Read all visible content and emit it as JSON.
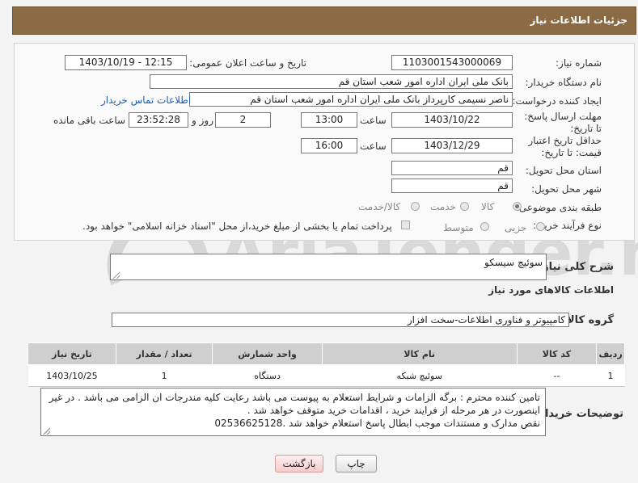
{
  "header": {
    "title": "جزئیات اطلاعات نیاز"
  },
  "form": {
    "need_number_label": "شماره نیاز:",
    "need_number": "1103001543000069",
    "announce_label": "تاریخ و ساعت اعلان عمومی:",
    "announce_value": "1403/10/19 - 12:15",
    "buyer_label": "نام دستگاه خریدار:",
    "buyer_value": "بانک ملی ایران اداره امور شعب استان قم",
    "creator_label": "ایجاد کننده درخواست:",
    "creator_value": "ناصر  نسیمی  کارپرداز  بانک ملی ایران اداره امور شعب استان قم",
    "contact_link": "اطلاعات تماس خریدار",
    "reply_deadline_label": "مهلت ارسال پاسخ: تا تاریخ:",
    "reply_date": "1403/10/22",
    "time_label": "ساعت",
    "reply_time": "13:00",
    "days_value": "2",
    "days_label": "روز و",
    "remaining_time": "23:52:28",
    "remaining_label": "ساعت باقی مانده",
    "price_deadline_label": "حداقل تاریخ اعتبار قیمت: تا تاریخ:",
    "price_date": "1403/12/29",
    "price_time": "16:00",
    "province_label": "استان محل تحویل:",
    "province_value": "قم",
    "city_label": "شهر محل تحویل:",
    "city_value": "قم",
    "category_label": "طبقه بندی موضوعی:",
    "category_options": [
      "کالا",
      "خدمت",
      "کالا/خدمت"
    ],
    "category_selected": "کالا",
    "process_label": "نوع فرآیند خرید :",
    "process_options": [
      "جزیی",
      "متوسط"
    ],
    "payment_note": "پرداخت تمام یا بخشی از مبلغ خرید،از محل \"اسناد خزانه اسلامی\" خواهد بود."
  },
  "description": {
    "label": "شرح کلی نیاز:",
    "value": "سوئیچ سیسکو"
  },
  "goods": {
    "section_title": "اطلاعات کالاهای مورد نیاز",
    "group_label": "گروه کالا:",
    "group_value": "کامپیوتر و فناوری اطلاعات-سخت افزار",
    "columns": [
      "ردیف",
      "کد کالا",
      "نام کالا",
      "واحد شمارش",
      "تعداد / مقدار",
      "تاریخ نیاز"
    ],
    "rows": [
      [
        "1",
        "--",
        "سوئیچ شبکه",
        "دستگاه",
        "1",
        "1403/10/25"
      ]
    ]
  },
  "buyer_notes": {
    "label": "توضیحات خریدار:",
    "lines": [
      "تامین کننده محترم : برگه الزامات و شرایط استعلام به پیوست می باشد رعایت کلیه مندرجات ان الزامی می باشد . در غیر",
      "اینصورت در هر مرحله از فرایند خرید ، اقدامات خرید متوقف خواهد شد .",
      "نقص  مدارک و مستندات موجب ابطال  پاسخ استعلام خواهد شد .02536625128"
    ]
  },
  "buttons": {
    "print": "چاپ",
    "back": "بازگشت"
  },
  "watermark": {
    "text": "AriaTender.net"
  },
  "colors": {
    "header_bg": "#8b6b44",
    "link": "#1a5fb4"
  }
}
